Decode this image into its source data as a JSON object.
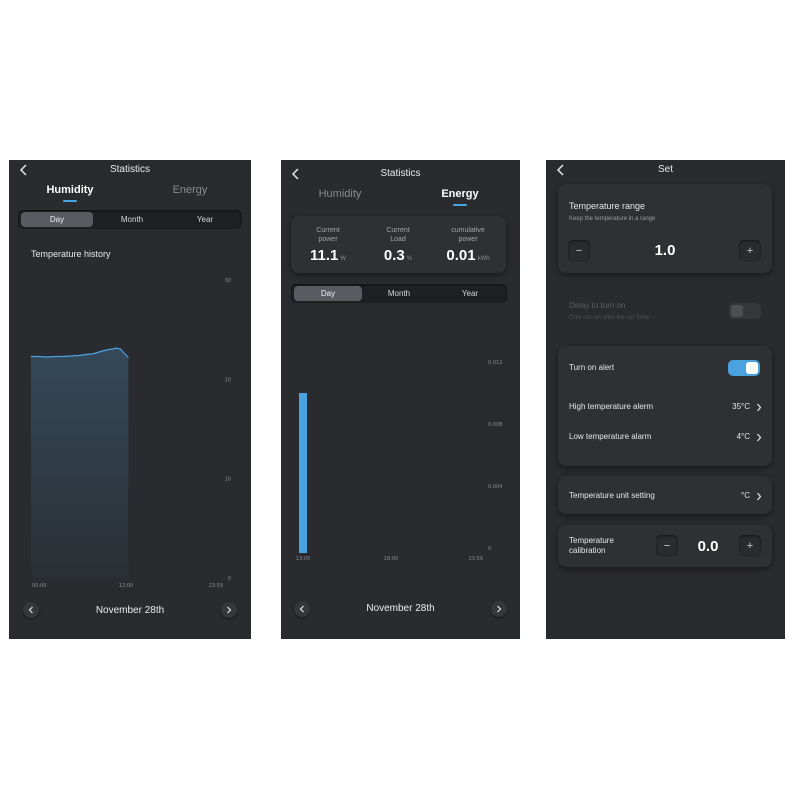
{
  "humidity_screen": {
    "title": "Statistics",
    "tabs": [
      "Humidity",
      "Energy"
    ],
    "active_tab": "Humidity",
    "periods": [
      "Day",
      "Month",
      "Year"
    ],
    "active_period": "Day",
    "chart_title": "Temperature history",
    "date": "November 28th"
  },
  "energy_screen": {
    "title": "Statistics",
    "tabs": [
      "Humidity",
      "Energy"
    ],
    "active_tab": "Energy",
    "stats": [
      {
        "label": "Current power",
        "value": "11.1",
        "unit": "W"
      },
      {
        "label": "Current Load",
        "value": "0.3",
        "unit": "%"
      },
      {
        "label": "cumulative power",
        "value": "0.01",
        "unit": "kWh"
      }
    ],
    "periods": [
      "Day",
      "Month",
      "Year"
    ],
    "active_period": "Day",
    "date": "November 28th"
  },
  "settings_screen": {
    "title": "Set",
    "temperature_range": {
      "title": "Temperature range",
      "subtitle": "Keep the temperature in a range",
      "value": "1.0",
      "minus": "−",
      "plus": "+"
    },
    "delay": {
      "title": "Delay to turn on",
      "subtitle": "Only can on after the set Time",
      "on": false
    },
    "alert": {
      "title": "Turn on alert",
      "on": true
    },
    "high_alarm": {
      "label": "High temperature alerm",
      "value": "35°C"
    },
    "low_alarm": {
      "label": "Low temperature alarm",
      "value": "4°C"
    },
    "unit_setting": {
      "label": "Temperature unit setting",
      "value": "°C"
    },
    "calibration": {
      "label": "Temperature calibration",
      "value": "0.0",
      "minus": "−",
      "plus": "+"
    }
  },
  "colors": {
    "background": "#2a2b2e",
    "accent": "#4aa3df",
    "card": "#2f3034"
  },
  "chart_data": [
    {
      "type": "area",
      "title": "Temperature history",
      "x_ticks": [
        "00:00",
        "12:00",
        "23:59"
      ],
      "y_ticks": [
        "0",
        "10",
        "20",
        "30"
      ],
      "ylim": [
        0,
        30
      ],
      "xlim_hours": [
        0,
        24
      ],
      "grid": false,
      "series": [
        {
          "x": [
            0,
            1,
            2,
            3,
            4,
            5,
            6,
            7,
            8,
            9,
            9.8,
            10.3,
            10.8,
            11.3,
            11.8,
            12.3
          ],
          "y": [
            22.3,
            22.3,
            22.25,
            22.3,
            22.3,
            22.35,
            22.4,
            22.5,
            22.6,
            22.85,
            23.0,
            23.05,
            23.15,
            23.05,
            22.6,
            22.2
          ]
        }
      ]
    },
    {
      "type": "bar",
      "x_ticks": [
        "13:00",
        "18:00",
        "23:59"
      ],
      "y_ticks": [
        "0",
        "0.004",
        "0.008",
        "0.012"
      ],
      "ylim": [
        0,
        0.012
      ],
      "grid": false,
      "bars": [
        {
          "x": "13:00",
          "value": 0.01
        }
      ]
    }
  ]
}
